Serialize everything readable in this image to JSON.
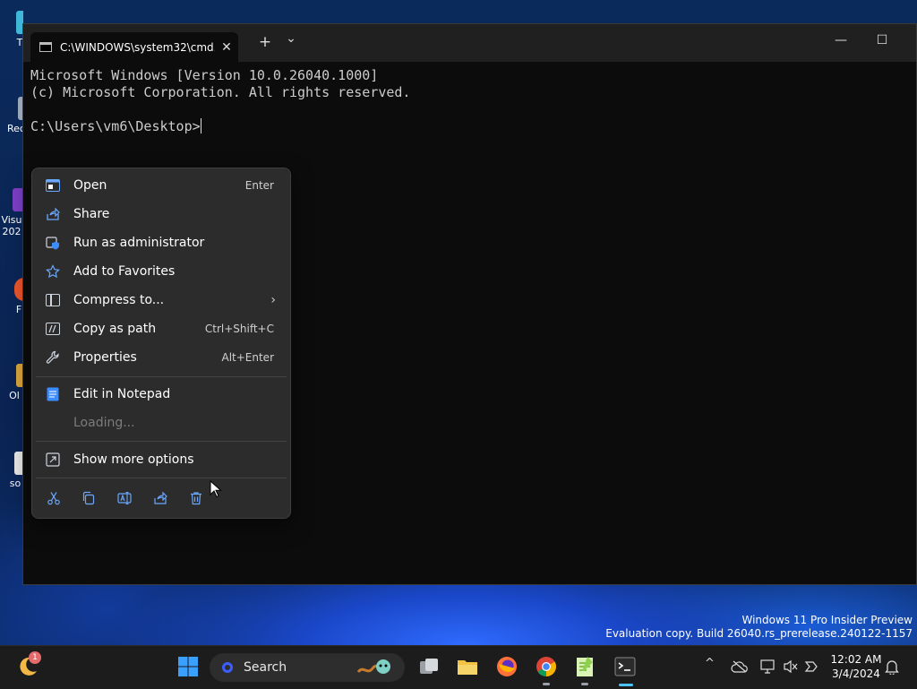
{
  "desktop": {
    "icons": [
      {
        "label": "T"
      },
      {
        "label": "Rec"
      },
      {
        "label": "Visu 202"
      },
      {
        "label": "F"
      },
      {
        "label": "Ol"
      },
      {
        "label": "so"
      }
    ],
    "watermark": {
      "line1": "Windows 11 Pro Insider Preview",
      "line2": "Evaluation copy. Build 26040.rs_prerelease.240122-1157"
    }
  },
  "terminal": {
    "tab_title": "C:\\WINDOWS\\system32\\cmd.",
    "tab_close": "✕",
    "new_tab": "+",
    "dropdown": "⌄",
    "minimize": "—",
    "maximize": "☐",
    "lines": [
      "Microsoft Windows [Version 10.0.26040.1000]",
      "(c) Microsoft Corporation. All rights reserved.",
      "",
      "C:\\Users\\vm6\\Desktop>"
    ]
  },
  "context_menu": {
    "items": [
      {
        "label": "Open",
        "shortcut": "Enter",
        "icon": "open-icon"
      },
      {
        "label": "Share",
        "shortcut": "",
        "icon": "share-icon"
      },
      {
        "label": "Run as administrator",
        "shortcut": "",
        "icon": "shield-icon"
      },
      {
        "label": "Add to Favorites",
        "shortcut": "",
        "icon": "star-icon"
      },
      {
        "label": "Compress to...",
        "shortcut": "",
        "icon": "zip-icon",
        "submenu": "›"
      },
      {
        "label": "Copy as path",
        "shortcut": "Ctrl+Shift+C",
        "icon": "path-icon"
      },
      {
        "label": "Properties",
        "shortcut": "Alt+Enter",
        "icon": "wrench-icon"
      },
      {
        "label": "Edit in Notepad",
        "shortcut": "",
        "icon": "notepad-icon"
      },
      {
        "label": "Loading...",
        "shortcut": "",
        "icon": "",
        "disabled": true
      },
      {
        "label": "Show more options",
        "shortcut": "",
        "icon": "more-options-icon"
      }
    ],
    "quick_actions": [
      "cut-icon",
      "copy-icon",
      "rename-icon",
      "share-icon",
      "delete-icon"
    ]
  },
  "taskbar": {
    "widget_badge": "1",
    "search_label": "Search",
    "tray_chevron": "^",
    "clock_time": "12:02 AM",
    "clock_date": "3/4/2024"
  },
  "colors": {
    "accent": "#4cc2ff",
    "menu_bg": "#2c2c2c",
    "console_bg": "#0c0c0c"
  }
}
